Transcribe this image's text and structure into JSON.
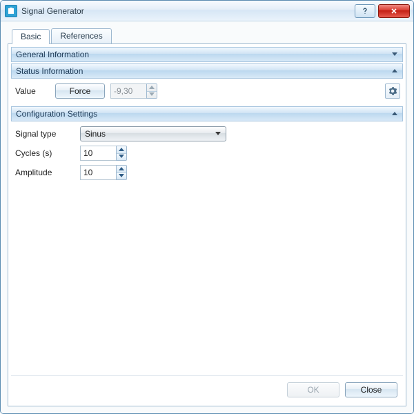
{
  "window": {
    "title": "Signal Generator"
  },
  "tabs": {
    "basic": "Basic",
    "references": "References"
  },
  "sections": {
    "general": "General Information",
    "status": "Status Information",
    "config": "Configuration Settings"
  },
  "status": {
    "value_label": "Value",
    "force_button": "Force",
    "value": "-9,30"
  },
  "config": {
    "signal_type_label": "Signal type",
    "signal_type_value": "Sinus",
    "cycles_label": "Cycles (s)",
    "cycles_value": "10",
    "amplitude_label": "Amplitude",
    "amplitude_value": "10"
  },
  "footer": {
    "ok": "OK",
    "close": "Close"
  },
  "icons": {
    "gear": "gear-icon",
    "chev_down": "chevron-down-icon",
    "chev_up": "chevron-up-icon"
  }
}
